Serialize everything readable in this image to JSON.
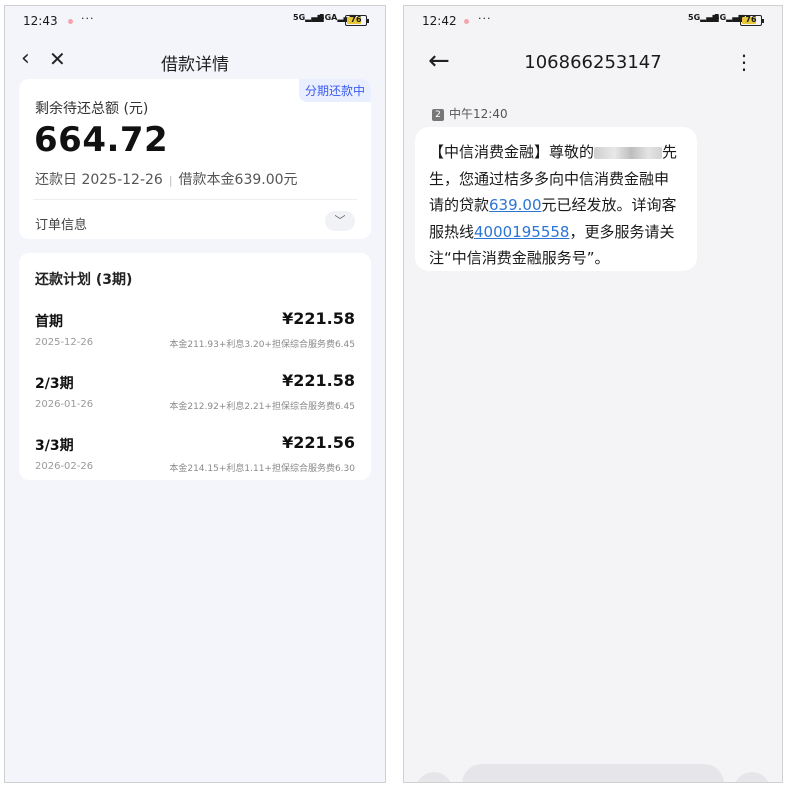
{
  "left": {
    "status": {
      "time": "12:43",
      "more": "···",
      "signal1": "5G",
      "signal2": "5GA",
      "battery": "76"
    },
    "header": {
      "title": "借款详情",
      "back_icon": "chevron-left-icon",
      "close_icon": "close-icon"
    },
    "summary": {
      "badge": "分期还款中",
      "label": "剩余待还总额 (元)",
      "amount": "664.72",
      "due_date": "还款日 2025-12-26",
      "principal": "借款本金639.00元",
      "order_info": "订单信息"
    },
    "plan": {
      "title": "还款计划 (3期)",
      "rows": [
        {
          "name": "首期",
          "amount": "¥221.58",
          "date": "2025-12-26",
          "detail": "本金211.93+利息3.20+担保综合服务费6.45"
        },
        {
          "name": "2/3期",
          "amount": "¥221.58",
          "date": "2026-01-26",
          "detail": "本金212.92+利息2.21+担保综合服务费6.45"
        },
        {
          "name": "3/3期",
          "amount": "¥221.56",
          "date": "2026-02-26",
          "detail": "本金214.15+利息1.11+担保综合服务费6.30"
        }
      ]
    }
  },
  "right": {
    "status": {
      "time": "12:42",
      "more": "···",
      "signal1": "5G",
      "signal2": "5G",
      "battery": "76"
    },
    "header": {
      "number": "106866253147"
    },
    "sim": {
      "slot": "2",
      "time": "中午12:40"
    },
    "message": {
      "part1": "【中信消费金融】尊敬的",
      "part2": "先生，您通过桔多多向中信消费金融申请的贷款",
      "amount_link": "639.00",
      "part3": "元已经发放。详询客服热线",
      "phone_link": "4000195558",
      "part4": "，更多服务请关注“中信消费金融服务号”。"
    }
  }
}
